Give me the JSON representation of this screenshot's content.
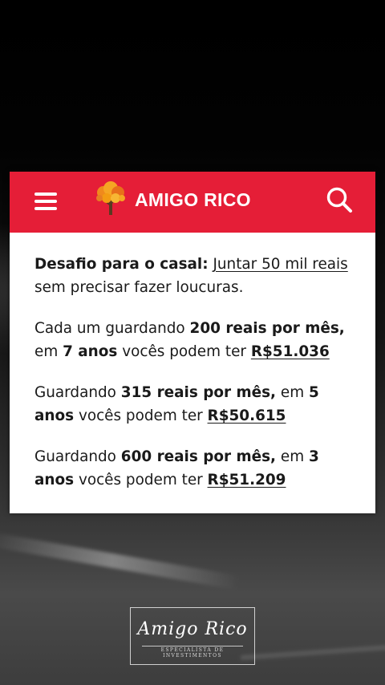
{
  "header": {
    "brand": "AMIGO RICO",
    "menu_icon": "hamburger-menu-icon",
    "logo_icon": "tree-icon",
    "search_icon": "search-icon",
    "accent_color": "#e51e37"
  },
  "content": {
    "p1": {
      "bold": "Desafio para o casal:",
      "link": "Juntar 50 mil reais",
      "rest": "sem precisar fazer loucuras."
    },
    "p2": {
      "t1": "Cada um guardando ",
      "b1": "200 reais por mês,",
      "t2": "em ",
      "b2": "7 anos",
      "t3": " vocês podem ter ",
      "amount": "R$51.036"
    },
    "p3": {
      "t1": "Guardando ",
      "b1": "315 reais por mês,",
      "t2": " em ",
      "b2a": "5",
      "b2b": "anos",
      "t3": " vocês podem ter ",
      "amount": "R$50.615"
    },
    "p4": {
      "t1": "Guardando ",
      "b1": "600 reais por mês,",
      "t2": " em ",
      "b2a": "3",
      "b2b": "anos",
      "t3": " vocês podem ter ",
      "amount": "R$51.209"
    }
  },
  "signature": {
    "name": "Amigo Rico",
    "subtitle": "ESPECIALISTA DE INVESTIMENTOS"
  }
}
